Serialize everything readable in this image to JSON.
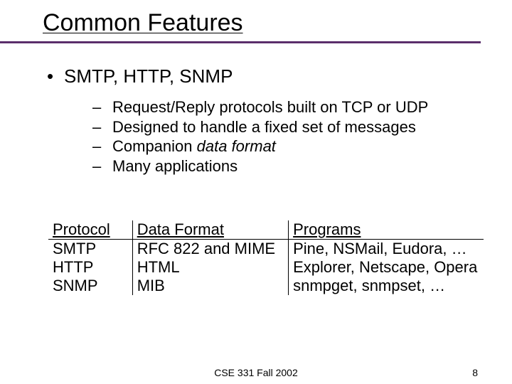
{
  "title": "Common Features",
  "bullet1": "SMTP, HTTP, SNMP",
  "sub": {
    "a": "Request/Reply protocols built on TCP or UDP",
    "b": "Designed to handle a fixed set of messages",
    "c_prefix": "Companion ",
    "c_italic": "data format",
    "d": "Many applications"
  },
  "table": {
    "headers": {
      "protocol": "Protocol",
      "format": "Data Format",
      "programs": "Programs"
    },
    "rows": [
      {
        "protocol": "SMTP",
        "format": "RFC 822 and MIME",
        "programs": "Pine, NSMail, Eudora, …"
      },
      {
        "protocol": "HTTP",
        "format": "HTML",
        "programs": "Explorer, Netscape, Opera"
      },
      {
        "protocol": "SNMP",
        "format": "MIB",
        "programs": "snmpget, snmpset, …"
      }
    ]
  },
  "footer": {
    "center": "CSE 331 Fall 2002",
    "pagenum": "8"
  }
}
